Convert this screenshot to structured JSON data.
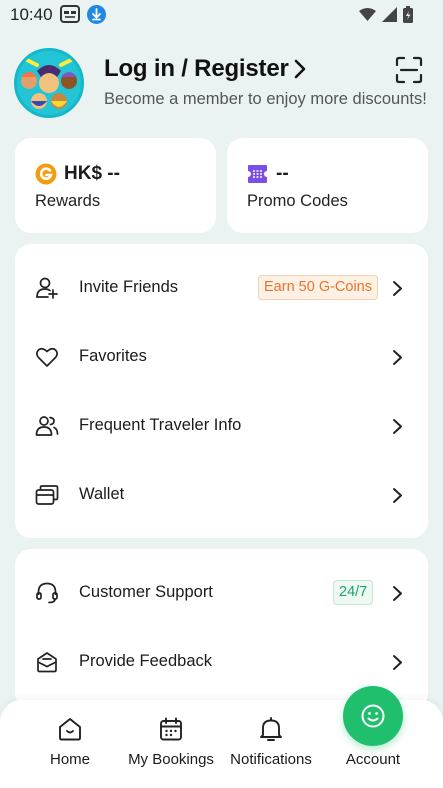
{
  "status_bar": {
    "time": "10:40"
  },
  "header": {
    "login_title": "Log in / Register",
    "subtitle": "Become a member to enjoy more discounts!"
  },
  "rewards": {
    "value": "HK$ --",
    "label": "Rewards"
  },
  "promo": {
    "value": "--",
    "label": "Promo Codes"
  },
  "menu_group_1": [
    {
      "label": "Invite Friends",
      "badge": "Earn 50 G-Coins",
      "icon": "add-user-icon"
    },
    {
      "label": "Favorites",
      "icon": "heart-icon"
    },
    {
      "label": "Frequent Traveler Info",
      "icon": "travelers-icon"
    },
    {
      "label": "Wallet",
      "icon": "wallet-icon"
    }
  ],
  "menu_group_2": [
    {
      "label": "Customer Support",
      "badge": "24/7",
      "icon": "headset-icon"
    },
    {
      "label": "Provide Feedback",
      "icon": "feedback-icon"
    }
  ],
  "bottom_nav": [
    {
      "label": "Home",
      "icon": "home-icon"
    },
    {
      "label": "My Bookings",
      "icon": "calendar-icon"
    },
    {
      "label": "Notifications",
      "icon": "bell-icon"
    },
    {
      "label": "Account",
      "icon": "smile-icon",
      "active": true
    }
  ],
  "colors": {
    "background": "#eaf3f2",
    "accent_green": "#1fbf6e",
    "badge_orange": "#e8742a",
    "coin_orange": "#f39c12",
    "ticket_purple": "#7b4ee4"
  }
}
